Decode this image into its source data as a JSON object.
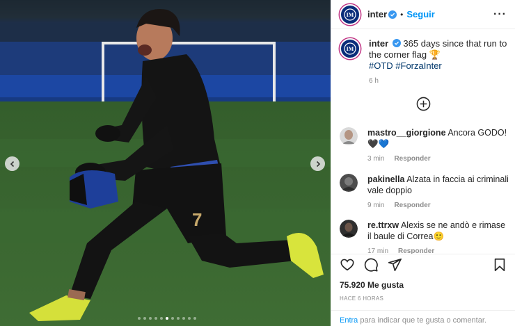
{
  "post": {
    "username": "inter",
    "follow_label": "Seguir",
    "more_icon": "more-horizontal-icon"
  },
  "caption": {
    "username": "inter",
    "text": "365 days since that run to the corner flag 🏆",
    "hashtags": "#OTD #ForzaInter",
    "time": "6 h"
  },
  "comments": [
    {
      "username": "mastro__giorgione",
      "text": "Ancora GODO! 🖤💙",
      "time": "3 min",
      "reply_label": "Responder"
    },
    {
      "username": "pakinella",
      "text": "Alzata in faccia ai criminali vale doppio",
      "time": "9 min",
      "reply_label": "Responder"
    },
    {
      "username": "re.ttrxw",
      "text": "Alexis se ne andò e rimase il baule di Correa🙂",
      "time": "17 min",
      "reply_label": "Responder"
    }
  ],
  "engagement": {
    "likes": "75.920 Me gusta",
    "posted_ago": "HACE 6 HORAS"
  },
  "login": {
    "link": "Entra",
    "text": " para indicar que te gusta o comentar."
  },
  "carousel": {
    "slide_count": 11,
    "active_index": 5
  },
  "colors": {
    "link_blue": "#0095f6",
    "hashtag_blue": "#00376b",
    "inter_blue": "#0a2d7a"
  }
}
